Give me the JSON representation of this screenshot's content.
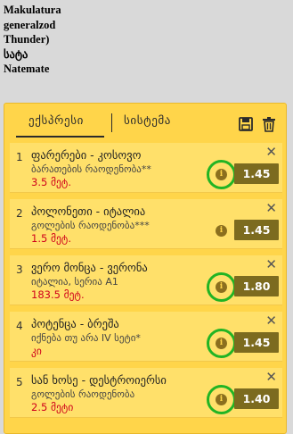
{
  "header_text": [
    "Makulatura",
    "generalzod",
    "Thunder)",
    "სატა",
    "Natemate"
  ],
  "tabs": {
    "express": "ექსპრესი",
    "system": "სისტემა"
  },
  "toolbar": {
    "save_icon": "save-icon",
    "trash_icon": "trash-icon"
  },
  "colors": {
    "panel": "#ffd54a",
    "odds_button": "#7c6b1f",
    "stake_text": "#d0021b",
    "highlight_ring": "#22b424"
  },
  "slips": [
    {
      "num": "1",
      "title": "ფარერები - კოსოვო",
      "sub": "ბარათების რაოდენობა**",
      "stake": "3.5 მეტ.",
      "odds": "1.45",
      "highlighted": true
    },
    {
      "num": "2",
      "title": "პოლონეთი - იტალია",
      "sub": "გოლების რაოდენობა***",
      "stake": "1.5 მეტ.",
      "odds": "1.45",
      "highlighted": false
    },
    {
      "num": "3",
      "title": "ვერო მონცა - ვერონა",
      "sub": "იტალია, სერია A1",
      "stake": "183.5 მეტ.",
      "odds": "1.80",
      "highlighted": true
    },
    {
      "num": "4",
      "title": "პოტენცა - ბრეშა",
      "sub": "იქნება თუ არა IV სეტი*",
      "stake": "კი",
      "odds": "1.45",
      "highlighted": true
    },
    {
      "num": "5",
      "title": "სან ხოსე - დესტროიერსი",
      "sub": "გოლების რაოდენობა",
      "stake": "2.5 მეტი",
      "odds": "1.40",
      "highlighted": true
    }
  ]
}
